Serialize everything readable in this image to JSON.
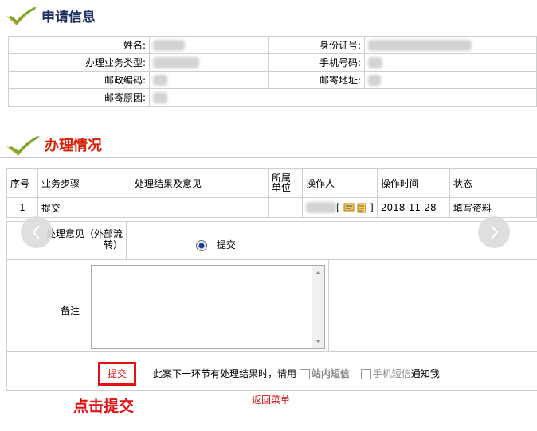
{
  "section1": {
    "title": "申请信息"
  },
  "applicant": {
    "name_label": "姓名:",
    "id_label": "身份证号:",
    "business_type_label": "办理业务类型:",
    "phone_label": "手机号码:",
    "postcode_label": "邮政编码:",
    "address_label": "邮寄地址:",
    "reason_label": "邮寄原因:"
  },
  "section2": {
    "title": "办理情况"
  },
  "process_table": {
    "headers": [
      "序号",
      "业务步骤",
      "处理结果及意见",
      "所属单位",
      "操作人",
      "操作时间",
      "状态"
    ],
    "rows": [
      {
        "index": "1",
        "step": "提交",
        "result": "",
        "unit": "",
        "operator_suffix": "[",
        "time": "2018-11-28",
        "status": "填写资料"
      }
    ]
  },
  "form": {
    "opinion_label": "处理意见（外部流转）",
    "opinion_label_line1": "处理意见（外部流",
    "opinion_label_line2": "转）",
    "option_selected": "提交",
    "remark_label": "备注",
    "submit_label": "提交",
    "notice_prefix": "此案下一环节有处理结果时，请用",
    "site_message": "站内短信",
    "sms": "手机短信",
    "notice_suffix": "通知我",
    "back_link": "返回菜单"
  },
  "annotation": {
    "text": "点击提交",
    "color": "#e01212"
  },
  "colors": {
    "title_blue": "#1c2f5e",
    "title_red": "#d81e06",
    "border": "#cfcfcf"
  },
  "icons": [
    "checkmark-brush-icon",
    "message-icon",
    "document-icon",
    "chevron-left-icon",
    "chevron-right-icon",
    "radio-selected-icon"
  ]
}
